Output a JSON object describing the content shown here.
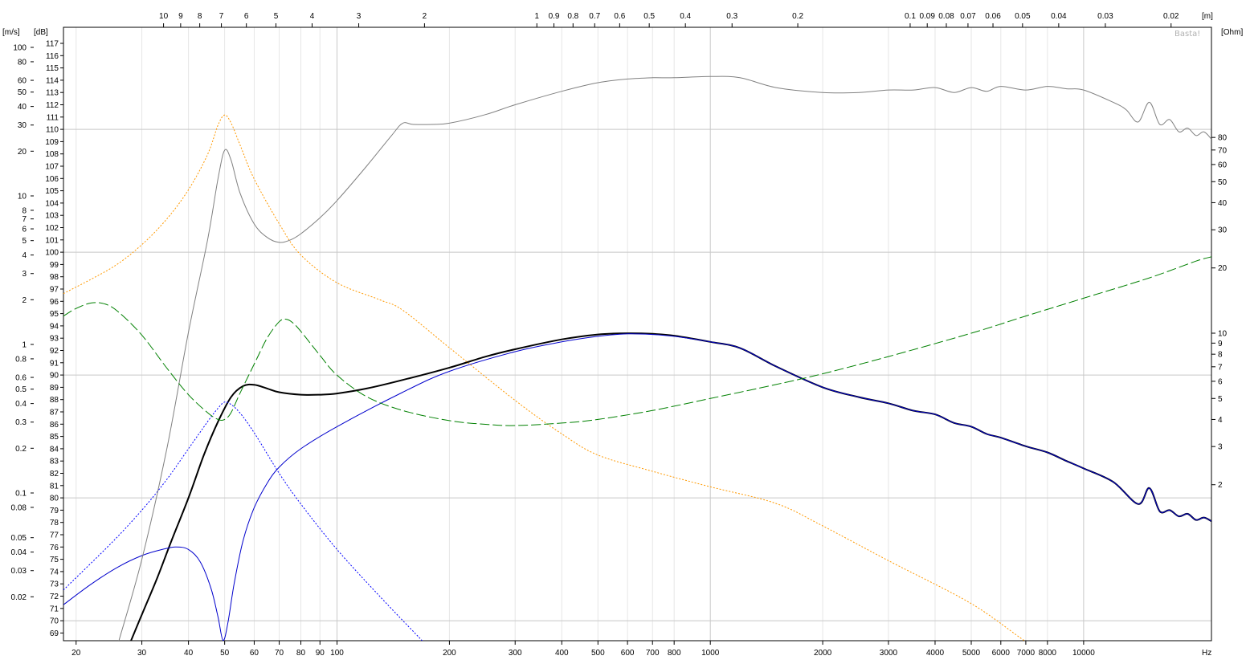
{
  "chart_data": {
    "type": "line",
    "watermark": "Basta!",
    "x_axis": {
      "label": "Hz",
      "scale": "log",
      "range": [
        18.5,
        22000
      ],
      "ticks": [
        20,
        30,
        40,
        50,
        60,
        70,
        80,
        90,
        100,
        200,
        300,
        400,
        500,
        600,
        700,
        800,
        1000,
        2000,
        3000,
        4000,
        5000,
        6000,
        7000,
        8000,
        10000
      ],
      "tick_labels": [
        "20",
        "30",
        "40",
        "50",
        "60",
        "70",
        "80",
        "90",
        "100",
        "200",
        "300",
        "400",
        "500",
        "600",
        "700",
        "800",
        "1000",
        "2000",
        "3000",
        "4000",
        "5000",
        "6000",
        "7000",
        "8000",
        "10000"
      ]
    },
    "wavelength_axis": {
      "unit": "[m]",
      "tick_labels": [
        "10",
        "9",
        "8",
        "7",
        "6",
        "5",
        "4",
        "3",
        "2",
        "1",
        "0.9",
        "0.8",
        "0.7",
        "0.6",
        "0.5",
        "0.4",
        "0.3",
        "0.2",
        "0.1",
        "0.09",
        "0.08",
        "0.07",
        "0.06",
        "0.05",
        "0.04",
        "0.03",
        "0.02"
      ]
    },
    "spl_axis": {
      "unit": "[dB]",
      "range": [
        68.3,
        118
      ],
      "tick_labels": [
        "69",
        "70",
        "71",
        "72",
        "73",
        "74",
        "75",
        "76",
        "77",
        "78",
        "79",
        "80",
        "81",
        "82",
        "83",
        "84",
        "85",
        "86",
        "87",
        "88",
        "89",
        "90",
        "91",
        "92",
        "93",
        "94",
        "95",
        "96",
        "97",
        "98",
        "99",
        "100",
        "101",
        "102",
        "103",
        "104",
        "105",
        "106",
        "107",
        "108",
        "109",
        "110",
        "111",
        "112",
        "113",
        "114",
        "115",
        "116",
        "117"
      ]
    },
    "velocity_axis": {
      "unit": "[m/s]",
      "tick_labels": [
        "100",
        "80",
        "60",
        "50",
        "40",
        "30",
        "20",
        "10",
        "8",
        "7",
        "6",
        "5",
        "4",
        "3",
        "2",
        "1",
        "0.8",
        "0.6",
        "0.5",
        "0.4",
        "0.3",
        "0.2",
        "0.1",
        "0.08",
        "0.05",
        "0.04",
        "0.03",
        "0.02"
      ],
      "tick_values": [
        100,
        80,
        60,
        50,
        40,
        30,
        20,
        10,
        8,
        7,
        6,
        5,
        4,
        3,
        2,
        1,
        0.8,
        0.6,
        0.5,
        0.4,
        0.3,
        0.2,
        0.1,
        0.08,
        0.05,
        0.04,
        0.03,
        0.02
      ]
    },
    "impedance_axis": {
      "unit": "[Ohm]",
      "tick_labels": [
        "80",
        "70",
        "60",
        "50",
        "40",
        "30",
        "20",
        "10",
        "9",
        "8",
        "7",
        "6",
        "5",
        "4",
        "3",
        "2"
      ],
      "tick_values": [
        80,
        70,
        60,
        50,
        40,
        30,
        20,
        10,
        9,
        8,
        7,
        6,
        5,
        4,
        3,
        2
      ]
    },
    "grid": true,
    "series": [
      {
        "axis": "spl",
        "color": "#000000",
        "style": "solid",
        "width": 2,
        "x": [
          28,
          30,
          33,
          36,
          40,
          44,
          48,
          52,
          56,
          60,
          65,
          70,
          80,
          90,
          100,
          120,
          150,
          200,
          250,
          300,
          400,
          500,
          600,
          700,
          800,
          1000,
          1200,
          1500,
          2000,
          2500,
          3000,
          3500,
          4000,
          4500,
          5000,
          5500,
          6000,
          7000,
          8000,
          9000,
          10000,
          12000,
          14000,
          15000,
          16000,
          17000,
          18000,
          19000,
          20000,
          21000,
          22000
        ],
        "y": [
          68.3,
          70.5,
          73.5,
          76.5,
          80.0,
          83.5,
          86.2,
          88.2,
          89.1,
          89.2,
          88.9,
          88.6,
          88.4,
          88.4,
          88.5,
          88.9,
          89.6,
          90.6,
          91.5,
          92.1,
          92.9,
          93.3,
          93.4,
          93.35,
          93.2,
          92.7,
          92.2,
          90.7,
          89.0,
          88.2,
          87.7,
          87.1,
          86.8,
          86.1,
          85.8,
          85.2,
          84.9,
          84.2,
          83.7,
          83.0,
          82.4,
          81.3,
          79.5,
          80.8,
          78.9,
          79.0,
          78.5,
          78.7,
          78.2,
          78.4,
          78.1
        ]
      },
      {
        "axis": "spl",
        "color": "#0000cc",
        "style": "solid",
        "width": 1,
        "x": [
          18.5,
          22,
          26,
          30,
          34,
          37,
          40,
          43,
          46,
          48,
          49.5,
          51,
          53,
          56,
          60,
          65,
          70,
          80,
          100,
          150,
          200,
          300,
          400,
          500,
          600,
          700,
          800,
          1000,
          1200,
          1500,
          2000,
          2500,
          3000,
          3500,
          4000,
          4500,
          5000,
          5500,
          6000,
          7000,
          8000,
          9000,
          10000,
          12000,
          14000,
          15000,
          16000,
          17000,
          18000,
          19000,
          20000,
          21000,
          22000
        ],
        "y": [
          71.3,
          73.0,
          74.4,
          75.3,
          75.8,
          76.0,
          75.8,
          74.8,
          72.6,
          70.3,
          68.4,
          69.8,
          73.0,
          76.5,
          79.2,
          81.2,
          82.5,
          84.0,
          85.8,
          88.6,
          90.3,
          91.9,
          92.7,
          93.15,
          93.35,
          93.3,
          93.15,
          92.7,
          92.2,
          90.7,
          89.0,
          88.2,
          87.7,
          87.1,
          86.8,
          86.1,
          85.8,
          85.2,
          84.9,
          84.2,
          83.7,
          83.0,
          82.4,
          81.3,
          79.5,
          80.8,
          78.9,
          79.0,
          78.5,
          78.7,
          78.2,
          78.4,
          78.1
        ]
      },
      {
        "axis": "spl",
        "color": "#0000ff",
        "style": "dotted",
        "width": 1,
        "x": [
          18.5,
          25,
          30,
          35,
          40,
          45,
          48,
          50,
          52,
          55,
          60,
          70,
          80,
          100,
          130,
          170
        ],
        "y": [
          72.5,
          76.4,
          79.0,
          81.5,
          84.0,
          86.2,
          87.3,
          87.8,
          87.6,
          86.9,
          85.3,
          82.0,
          79.5,
          75.8,
          72.0,
          68.3
        ]
      },
      {
        "axis": "spl",
        "color": "#808080",
        "style": "solid",
        "width": 1,
        "x": [
          26,
          30,
          35,
          40,
          45,
          48,
          50,
          52,
          55,
          60,
          65,
          70,
          75,
          80,
          90,
          100,
          120,
          140,
          150,
          160,
          180,
          200,
          250,
          300,
          400,
          500,
          600,
          700,
          800,
          1000,
          1200,
          1500,
          2000,
          2500,
          3000,
          3500,
          4000,
          4500,
          5000,
          5500,
          6000,
          7000,
          8000,
          9000,
          10000,
          12000,
          13000,
          14000,
          15000,
          16000,
          17000,
          18000,
          19000,
          20000,
          21000,
          22000
        ],
        "y": [
          68.3,
          75.0,
          84.0,
          93.5,
          101.0,
          106.0,
          108.3,
          107.5,
          104.8,
          102.3,
          101.2,
          100.8,
          101.0,
          101.5,
          102.8,
          104.2,
          107.0,
          109.5,
          110.5,
          110.4,
          110.4,
          110.5,
          111.2,
          112.0,
          113.1,
          113.8,
          114.1,
          114.2,
          114.2,
          114.3,
          114.2,
          113.4,
          113.0,
          113.0,
          113.2,
          113.2,
          113.4,
          113.0,
          113.4,
          113.1,
          113.5,
          113.2,
          113.5,
          113.3,
          113.2,
          112.2,
          111.6,
          110.6,
          112.2,
          110.4,
          110.8,
          109.8,
          110.1,
          109.5,
          109.8,
          109.2
        ]
      },
      {
        "axis": "velocity",
        "color": "#ff9900",
        "style": "dotted",
        "width": 1,
        "x": [
          18.5,
          25,
          30,
          35,
          40,
          45,
          48,
          50,
          52,
          55,
          60,
          70,
          80,
          100,
          130,
          150,
          200,
          300,
          400,
          500,
          700,
          1000,
          1500,
          2000,
          3000,
          5000,
          7000,
          8000
        ],
        "y": [
          2.2,
          3.3,
          4.7,
          7.0,
          11.0,
          19.0,
          30.0,
          35.0,
          31.0,
          22.0,
          13.0,
          6.5,
          4.0,
          2.6,
          2.0,
          1.7,
          0.95,
          0.42,
          0.25,
          0.18,
          0.14,
          0.11,
          0.085,
          0.06,
          0.035,
          0.018,
          0.01,
          0.0086
        ]
      },
      {
        "axis": "impedance",
        "color": "#008000",
        "style": "dashed",
        "width": 1,
        "x": [
          18.5,
          20,
          22,
          24,
          26,
          30,
          35,
          40,
          45,
          48,
          50,
          52,
          55,
          60,
          65,
          70,
          73,
          76,
          80,
          90,
          100,
          120,
          150,
          200,
          250,
          300,
          400,
          500,
          700,
          1000,
          1500,
          2000,
          3000,
          5000,
          7000,
          10000,
          15000,
          20000,
          22000
        ],
        "y": [
          12.0,
          13.0,
          13.8,
          13.6,
          12.5,
          9.8,
          6.9,
          5.2,
          4.3,
          4.0,
          4.0,
          4.3,
          5.3,
          7.2,
          9.5,
          11.3,
          11.6,
          11.2,
          10.2,
          7.9,
          6.4,
          5.1,
          4.4,
          3.95,
          3.8,
          3.75,
          3.85,
          4.0,
          4.4,
          5.0,
          5.8,
          6.5,
          7.8,
          10.0,
          12.0,
          14.5,
          18.0,
          21.5,
          22.5
        ]
      }
    ]
  }
}
